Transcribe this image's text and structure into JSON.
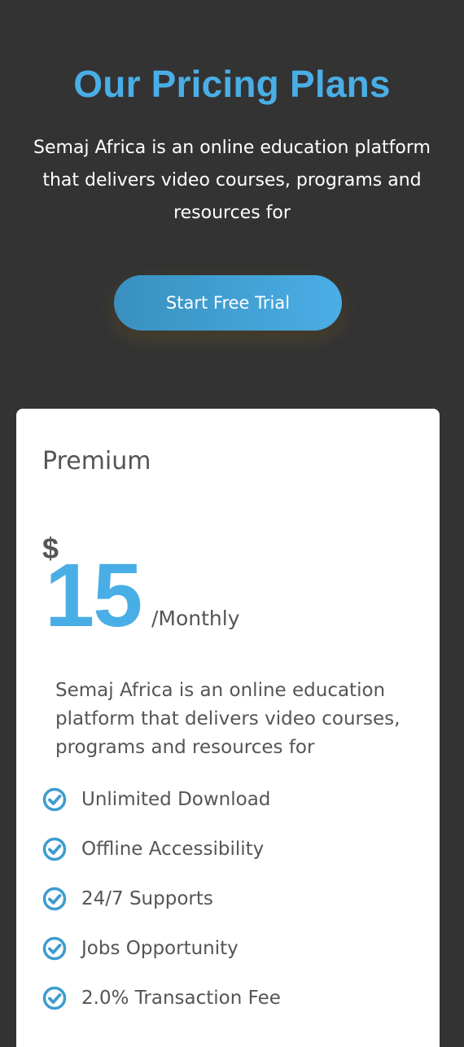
{
  "hero": {
    "title": "Our Pricing Plans",
    "subtitle": "Semaj Africa is an online education platform that delivers video courses, programs and resources for",
    "cta_label": "Start Free Trial"
  },
  "plan": {
    "name": "Premium",
    "currency": "$",
    "price": "15",
    "period": "/Monthly",
    "description": "Semaj Africa is an online education platform that delivers video courses, programs and resources for",
    "features": [
      {
        "label": "Unlimited Download",
        "icon": "check-circle-icon"
      },
      {
        "label": "Offline Accessibility",
        "icon": "check-circle-icon"
      },
      {
        "label": "24/7 Supports",
        "icon": "check-circle-icon"
      },
      {
        "label": "Jobs Opportunity",
        "icon": "check-circle-icon"
      },
      {
        "label": "2.0% Transaction Fee",
        "icon": "check-circle-icon"
      }
    ]
  },
  "colors": {
    "background": "#333333",
    "accent": "#4aaee6",
    "card": "#ffffff",
    "text_dark": "#555555",
    "text_light": "#ffffff"
  }
}
